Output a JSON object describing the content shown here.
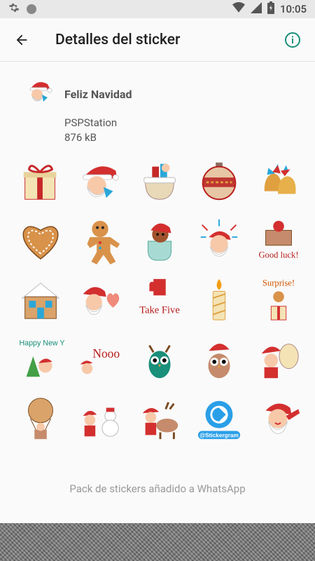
{
  "status_bar": {
    "time": "10:05",
    "icons": [
      "gear-icon",
      "circle-icon",
      "wifi-icon",
      "cellular-icon",
      "battery-icon"
    ]
  },
  "app_bar": {
    "title": "Detalles del sticker",
    "back_icon": "arrow-back-icon",
    "info_icon": "info-icon"
  },
  "pack": {
    "name": "Feliz Navidad",
    "publisher": "PSPStation",
    "size": "876 kB"
  },
  "stickers": [
    {
      "name": "gift-box"
    },
    {
      "name": "santa-peeking"
    },
    {
      "name": "stocking-gifts"
    },
    {
      "name": "ornament-ball"
    },
    {
      "name": "bells-poinsettia"
    },
    {
      "name": "heart-cookie"
    },
    {
      "name": "gingerbread-man"
    },
    {
      "name": "dog-stocking"
    },
    {
      "name": "santa-fireworks"
    },
    {
      "name": "good-luck",
      "text": "Good luck!"
    },
    {
      "name": "gingerbread-house"
    },
    {
      "name": "santa-heart"
    },
    {
      "name": "take-five",
      "text": "Take Five"
    },
    {
      "name": "candle"
    },
    {
      "name": "surprise",
      "text": "Surprise!"
    },
    {
      "name": "happy-new-year",
      "text": "Happy New Year!"
    },
    {
      "name": "nooo",
      "text": "Nooo"
    },
    {
      "name": "owl-reindeer"
    },
    {
      "name": "owl-santa"
    },
    {
      "name": "santa-sack"
    },
    {
      "name": "balloon-santa"
    },
    {
      "name": "santa-snowman"
    },
    {
      "name": "santa-reindeer"
    },
    {
      "name": "stickergram-logo",
      "text": "@Stickergram"
    },
    {
      "name": "santa-dab"
    }
  ],
  "footer": {
    "status": "Pack de stickers añadido a WhatsApp"
  },
  "colors": {
    "accent": "#1a8f7a",
    "santa_red": "#d32f2f",
    "gold": "#e0a040"
  }
}
